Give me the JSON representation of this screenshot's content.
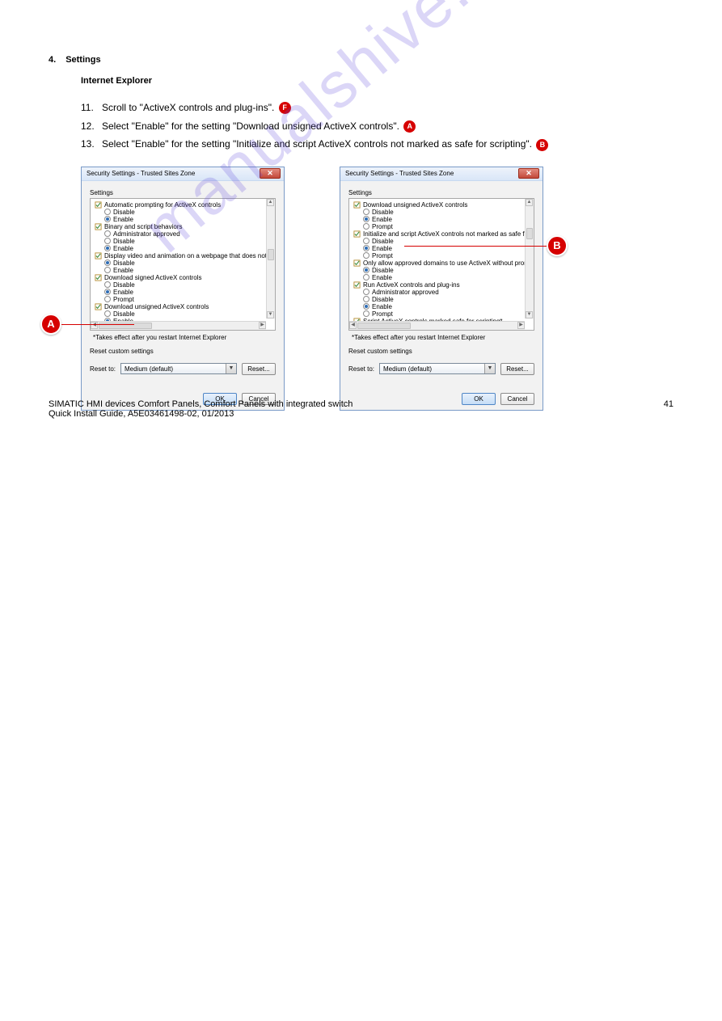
{
  "section": {
    "number": "4.",
    "title": "Settings"
  },
  "subsection": "Internet Explorer",
  "steps": [
    {
      "n": "11.",
      "text": "Scroll to \"ActiveX controls and plug-ins\"."
    },
    {
      "n": "12.",
      "text": "Select \"Enable\" for the setting \"Download unsigned ActiveX controls\"."
    },
    {
      "n": "13.",
      "text": "Select \"Enable\" for the setting \"Initialize and script ActiveX controls not marked as safe for scripting\"."
    }
  ],
  "stepAnnot": {
    "step12": "A",
    "step13": "B"
  },
  "circleLetter": "F",
  "dialog": {
    "title": "Security Settings - Trusted Sites Zone",
    "groupLabel": "Settings",
    "footnote": "*Takes effect after you restart Internet Explorer",
    "resetGroup": "Reset custom settings",
    "resetTo": "Reset to:",
    "resetValue": "Medium (default)",
    "resetBtn": "Reset...",
    "ok": "OK",
    "cancel": "Cancel"
  },
  "treeLeft": [
    {
      "label": "Automatic prompting for ActiveX controls",
      "opts": [
        {
          "t": "Disable",
          "sel": false
        },
        {
          "t": "Enable",
          "sel": true
        }
      ]
    },
    {
      "label": "Binary and script behaviors",
      "opts": [
        {
          "t": "Administrator approved",
          "sel": false
        },
        {
          "t": "Disable",
          "sel": false
        },
        {
          "t": "Enable",
          "sel": true
        }
      ]
    },
    {
      "label": "Display video and animation on a webpage that does not use",
      "opts": [
        {
          "t": "Disable",
          "sel": true
        },
        {
          "t": "Enable",
          "sel": false
        }
      ]
    },
    {
      "label": "Download signed ActiveX controls",
      "opts": [
        {
          "t": "Disable",
          "sel": false
        },
        {
          "t": "Enable",
          "sel": true
        },
        {
          "t": "Prompt",
          "sel": false
        }
      ]
    },
    {
      "label": "Download unsigned ActiveX controls",
      "opts": [
        {
          "t": "Disable",
          "sel": false
        },
        {
          "t": "Enable",
          "sel": true
        }
      ]
    }
  ],
  "treeRight": [
    {
      "label": "Download unsigned ActiveX controls",
      "opts": [
        {
          "t": "Disable",
          "sel": false
        },
        {
          "t": "Enable",
          "sel": true
        },
        {
          "t": "Prompt",
          "sel": false
        }
      ]
    },
    {
      "label": "Initialize and script ActiveX controls not marked as safe for s",
      "opts": [
        {
          "t": "Disable",
          "sel": false
        },
        {
          "t": "Enable",
          "sel": true
        },
        {
          "t": "Prompt",
          "sel": false
        }
      ]
    },
    {
      "label": "Only allow approved domains to use ActiveX without prompt",
      "opts": [
        {
          "t": "Disable",
          "sel": true
        },
        {
          "t": "Enable",
          "sel": false
        }
      ]
    },
    {
      "label": "Run ActiveX controls and plug-ins",
      "opts": [
        {
          "t": "Administrator approved",
          "sel": false
        },
        {
          "t": "Disable",
          "sel": false
        },
        {
          "t": "Enable",
          "sel": true
        },
        {
          "t": "Prompt",
          "sel": false
        }
      ]
    },
    {
      "label": "Script ActiveX controls marked safe for scripting*",
      "opts": []
    }
  ],
  "annotations": {
    "A": "A",
    "B": "B"
  },
  "watermark": "manualshive.com",
  "footer": {
    "left": "A5E03461498-02, 01/2013",
    "right": "41",
    "productLine1": "SIMATIC HMI devices Comfort Panels, Comfort Panels with integrated switch",
    "productLine2": "Quick Install Guide"
  }
}
